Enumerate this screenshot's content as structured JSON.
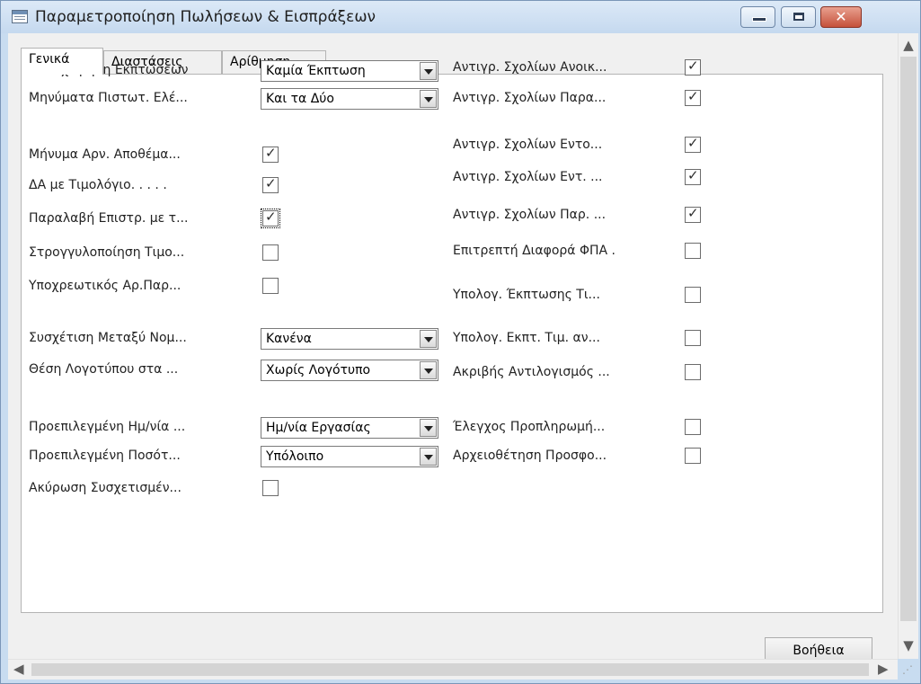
{
  "window": {
    "title": "Παραμετροποίηση Πωλήσεων & Εισπράξεων"
  },
  "tabs": [
    "Γενικά",
    "Διαστάσεις",
    "Αρίθμηση"
  ],
  "left_fields": [
    {
      "label": "Καταχώρηση Εκπτώσεων",
      "type": "combo",
      "value": "Καμία Έκπτωση"
    },
    {
      "label": "Μηνύματα Πιστωτ. Ελέ...",
      "type": "combo",
      "value": "Και τα Δύο"
    },
    {
      "label": "Μήνυμα Αρν. Αποθέμα...",
      "type": "check",
      "checked": true
    },
    {
      "label": "ΔΑ με Τιμολόγιο. . . . .",
      "type": "check",
      "checked": true
    },
    {
      "label": "Παραλαβή Επιστρ. με τ...",
      "type": "check",
      "checked": true
    },
    {
      "label": "Στρογγυλοποίηση Τιμο...",
      "type": "check",
      "checked": false
    },
    {
      "label": "Υποχρεωτικός Αρ.Παρ...",
      "type": "check",
      "checked": false
    },
    {
      "label": "Συσχέτιση Μεταξύ Νομ...",
      "type": "combo",
      "value": "Κανένα"
    },
    {
      "label": "Θέση Λογοτύπου στα ...",
      "type": "combo",
      "value": "Χωρίς Λογότυπο"
    },
    {
      "label": "Προεπιλεγμένη Ημ/νία ...",
      "type": "combo",
      "value": "Ημ/νία Εργασίας"
    },
    {
      "label": "Προεπιλεγμένη Ποσότ...",
      "type": "combo",
      "value": "Υπόλοιπο"
    },
    {
      "label": "Ακύρωση Συσχετισμέν...",
      "type": "check",
      "checked": false
    }
  ],
  "right_fields": [
    {
      "label": "Αντιγρ. Σχολίων Ανοικ...",
      "checked": true
    },
    {
      "label": "Αντιγρ. Σχολίων Παρα...",
      "checked": true
    },
    {
      "label": "Αντιγρ. Σχολίων Εντο...",
      "checked": true
    },
    {
      "label": "Αντιγρ. Σχολίων Εντ. ...",
      "checked": true
    },
    {
      "label": "Αντιγρ. Σχολίων Παρ. ...",
      "checked": true
    },
    {
      "label": "Επιτρεπτή Διαφορά ΦΠΑ .",
      "checked": false
    },
    {
      "label": "Υπολογ. Έκπτωσης Τι...",
      "checked": false
    },
    {
      "label": "Υπολογ. Εκπτ. Τιμ. αν...",
      "checked": false
    },
    {
      "label": "Ακριβής Αντιλογισμός ...",
      "checked": false
    },
    {
      "label": "Έλεγχος Προπληρωμή...",
      "checked": false
    },
    {
      "label": "Αρχειοθέτηση Προσφο...",
      "checked": false
    }
  ],
  "buttons": {
    "help": "Βοήθεια"
  },
  "icons": {
    "window": "form-window-icon",
    "minimize": "minimize-icon",
    "maximize": "maximize-icon",
    "close": "close-icon",
    "checkmark": "checkmark-icon",
    "dropdown": "dropdown-arrow-icon",
    "scroll_up": "scroll-up-icon",
    "scroll_down": "scroll-down-icon",
    "scroll_left": "scroll-left-icon",
    "scroll_right": "scroll-right-icon"
  },
  "colors": {
    "close_button": "#c5513b",
    "titlebar": "#c5d9ef"
  }
}
